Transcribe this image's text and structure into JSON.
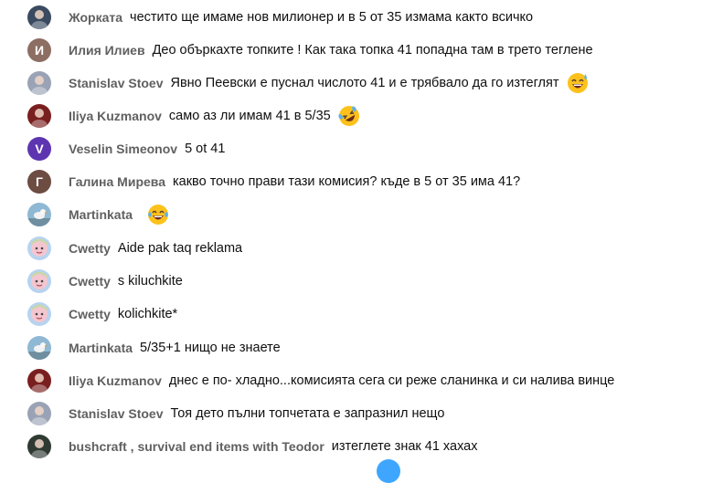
{
  "colors": {
    "author_text": "#606060",
    "message_text": "#0f0f0f",
    "background": "#ffffff"
  },
  "messages": [
    {
      "author": "Жорката",
      "text": "честито ще имаме нов милионер и в 5 от 35 измама както всичко",
      "avatar": {
        "kind": "photo",
        "icon": "person-photo-avatar",
        "color": "#3a4a60"
      }
    },
    {
      "author": "Илия Илиев",
      "text": "Део объркахте топките ! Как така топка 41 попадна там в трето теглене",
      "avatar": {
        "kind": "letter",
        "letter": "И",
        "color": "#8d6e63"
      }
    },
    {
      "author": "Stanislav Stoev",
      "text": "Явно Пеевски е пуснал числото 41 и е трябвало да го изтеглят",
      "emoji": "grinning-sweat-emoji",
      "avatar": {
        "kind": "photo",
        "icon": "person-photo-avatar",
        "color": "#9aa3b5"
      }
    },
    {
      "author": "Iliya Kuzmanov",
      "text": "само аз ли имам 41 в 5/35",
      "emoji": "rolling-laughing-emoji",
      "avatar": {
        "kind": "photo",
        "icon": "person-photo-avatar",
        "color": "#7a1f1f"
      }
    },
    {
      "author": "Veselin Simeonov",
      "text": "5 ot 41",
      "avatar": {
        "kind": "letter",
        "letter": "V",
        "color": "#5e35b1"
      }
    },
    {
      "author": "Галина Мирева",
      "text": "какво точно прави тази комисия? къде в 5 от 35 има 41?",
      "avatar": {
        "kind": "letter",
        "letter": "Г",
        "color": "#6d4c41"
      }
    },
    {
      "author": "Martinkata",
      "text": "",
      "emoji": "laughing-emoji",
      "avatar": {
        "kind": "photo",
        "icon": "seagull-photo-avatar",
        "color": "#8fb8d4"
      }
    },
    {
      "author": "Cwetty",
      "text": "Aide pak taq reklama",
      "avatar": {
        "kind": "photo",
        "icon": "cartoon-avatar",
        "color": "#b7d3ef"
      }
    },
    {
      "author": "Cwetty",
      "text": "s kiluchkite",
      "avatar": {
        "kind": "photo",
        "icon": "cartoon-avatar",
        "color": "#b7d3ef"
      }
    },
    {
      "author": "Cwetty",
      "text": "kolichkite*",
      "avatar": {
        "kind": "photo",
        "icon": "cartoon-avatar",
        "color": "#b7d3ef"
      }
    },
    {
      "author": "Martinkata",
      "text": "5/35+1 нищо не знаете",
      "avatar": {
        "kind": "photo",
        "icon": "seagull-photo-avatar",
        "color": "#8fb8d4"
      }
    },
    {
      "author": "Iliya Kuzmanov",
      "text": "днес е по- хладно...комисията сега си реже сланинка и си налива винце",
      "avatar": {
        "kind": "photo",
        "icon": "person-photo-avatar",
        "color": "#7a1f1f"
      }
    },
    {
      "author": "Stanislav Stoev",
      "text": "Тоя дето пълни топчетата е запразнил нещо",
      "avatar": {
        "kind": "photo",
        "icon": "person-photo-avatar",
        "color": "#9aa3b5"
      }
    },
    {
      "author": "bushcraft , survival end items with Teodor",
      "text": "изтеглете знак 41 хахах",
      "avatar": {
        "kind": "photo",
        "icon": "person-photo-avatar",
        "color": "#2f3a33"
      }
    }
  ]
}
